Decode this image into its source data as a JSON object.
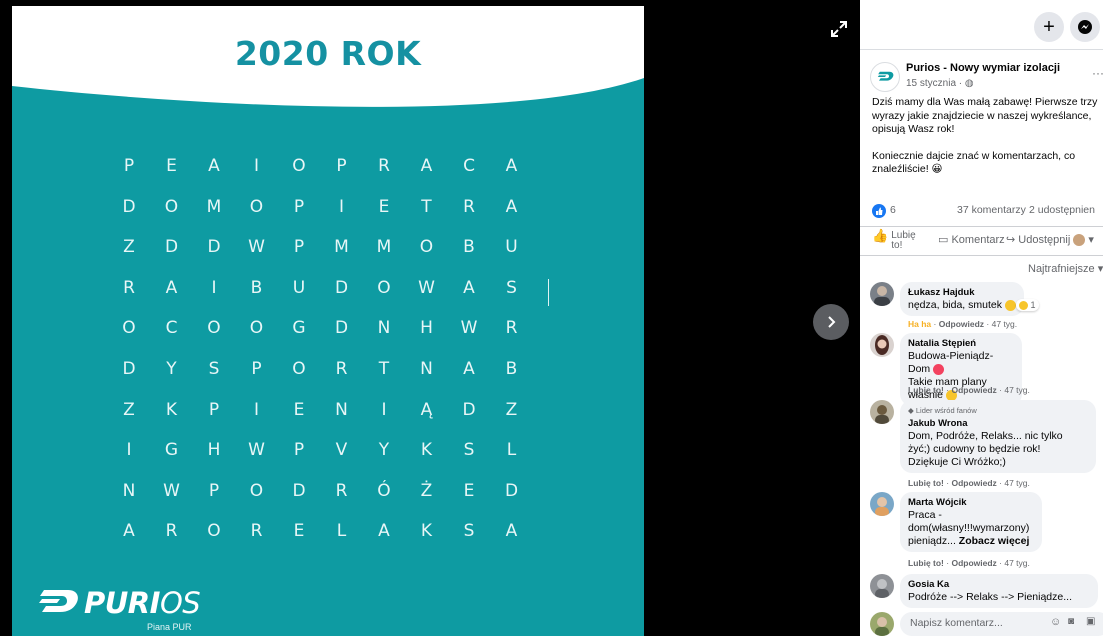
{
  "image": {
    "title": "2020 ROK",
    "grid": [
      [
        "P",
        "E",
        "A",
        "I",
        "O",
        "P",
        "R",
        "A",
        "C",
        "A"
      ],
      [
        "D",
        "O",
        "M",
        "O",
        "P",
        "I",
        "E",
        "T",
        "R",
        "A"
      ],
      [
        "Z",
        "D",
        "D",
        "W",
        "P",
        "M",
        "M",
        "O",
        "B",
        "U"
      ],
      [
        "R",
        "A",
        "I",
        "B",
        "U",
        "D",
        "O",
        "W",
        "A",
        "S"
      ],
      [
        "O",
        "C",
        "O",
        "O",
        "G",
        "D",
        "N",
        "H",
        "W",
        "R"
      ],
      [
        "D",
        "Y",
        "S",
        "P",
        "O",
        "R",
        "T",
        "N",
        "A",
        "B"
      ],
      [
        "Z",
        "K",
        "P",
        "I",
        "E",
        "N",
        "I",
        "Ą",
        "D",
        "Z"
      ],
      [
        "I",
        "G",
        "H",
        "W",
        "P",
        "V",
        "Y",
        "K",
        "S",
        "L"
      ],
      [
        "N",
        "W",
        "P",
        "O",
        "D",
        "R",
        "Ó",
        "Ż",
        "E",
        "D"
      ],
      [
        "A",
        "R",
        "O",
        "R",
        "E",
        "L",
        "A",
        "K",
        "S",
        "A"
      ]
    ],
    "logo_text_main": "PURI",
    "logo_text_tail": "OS",
    "logo_sub": "Piana PUR",
    "colors": {
      "teal": "#0e9ba2",
      "title": "#1591a2"
    }
  },
  "viewer": {
    "expand_icon": "expand-icon",
    "next_icon": "chevron-right-icon"
  },
  "panel": {
    "topbar": {
      "plus": "+",
      "messenger_icon": "messenger-icon"
    },
    "post": {
      "page_name": "Purios - Nowy wymiar izolacji",
      "date": "15 stycznia · ",
      "more": "···",
      "paragraph1": "Dziś mamy dla Was małą zabawę! Pierwsze trzy wyrazy jakie znajdziecie w naszej wykreślance, opisują Wasz rok!",
      "paragraph2": "Koniecznie dajcie znać w komentarzach, co znaleźliście! 😀"
    },
    "stats": {
      "likes": "6",
      "comments": "37 komentarzy",
      "shares": "2 udostępnien"
    },
    "actions": {
      "like": "Lubię to!",
      "comment": "Komentarz",
      "share": "Udostępnij"
    },
    "sort_label": "Najtrafniejsze",
    "comments": [
      {
        "author": "Łukasz Hajduk",
        "lines": [
          "nędza, bida, smutek"
        ],
        "reaction_count": "1",
        "meta_reaction": "Ha ha",
        "reply": "Odpowiedz",
        "time": "47 tyg.",
        "badge": ""
      },
      {
        "author": "Natalia Stępień",
        "lines": [
          "Budowa-Pieniądz-Dom",
          "Takie mam plany właśnie"
        ],
        "meta_reaction": "Lubię to!",
        "reply": "Odpowiedz",
        "time": "47 tyg.",
        "badge": ""
      },
      {
        "author": "Jakub Wrona",
        "badge": "Lider wśród fanów",
        "lines": [
          "Dom, Podróże, Relaks... nic tylko",
          "żyć;) cudowny to będzie rok!",
          "Dziękuje Ci Wróżko;)"
        ],
        "meta_reaction": "Lubię to!",
        "reply": "Odpowiedz",
        "time": "47 tyg."
      },
      {
        "author": "Marta Wójcik",
        "lines": [
          "Praca -",
          "dom(własny!!!wymarzony)",
          "pieniądz..."
        ],
        "see_more": "Zobacz więcej",
        "meta_reaction": "Lubię to!",
        "reply": "Odpowiedz",
        "time": "47 tyg.",
        "badge": ""
      },
      {
        "author": "Gosia Ka",
        "lines": [
          "Podróże --> Relaks --> Pieniądze..."
        ],
        "badge": ""
      }
    ],
    "compose_placeholder": "Napisz komentarz..."
  }
}
